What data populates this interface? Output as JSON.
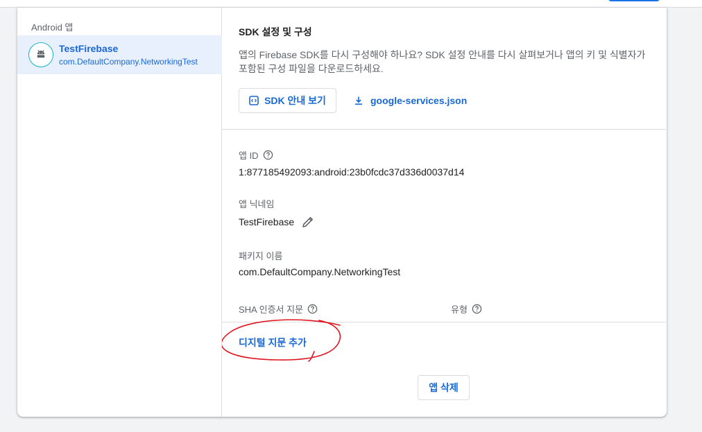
{
  "sidebar": {
    "title": "Android 앱",
    "app": {
      "name": "TestFirebase",
      "package": "com.DefaultCompany.NetworkingTest",
      "icon": "android-icon"
    }
  },
  "sdk": {
    "title": "SDK 설정 및 구성",
    "description": "앱의 Firebase SDK를 다시 구성해야 하나요? SDK 설정 안내를 다시 살펴보거나 앱의 키 및 식별자가 포함된 구성 파일을 다운로드하세요.",
    "guide_button": "SDK 안내 보기",
    "download_link": "google-services.json"
  },
  "details": {
    "app_id_label": "앱 ID",
    "app_id_value": "1:877185492093:android:23b0fcdc37d336d0037d14",
    "nickname_label": "앱 닉네임",
    "nickname_value": "TestFirebase",
    "package_label": "패키지 이름",
    "package_value": "com.DefaultCompany.NetworkingTest",
    "sha_label": "SHA 인증서 지문",
    "type_label": "유형"
  },
  "actions": {
    "add_fingerprint": "디지털 지문 추가",
    "delete_app": "앱 삭제"
  },
  "colors": {
    "accent": "#1967d2",
    "selected_bg": "#e8f0fe",
    "annotation": "#e0141e"
  }
}
